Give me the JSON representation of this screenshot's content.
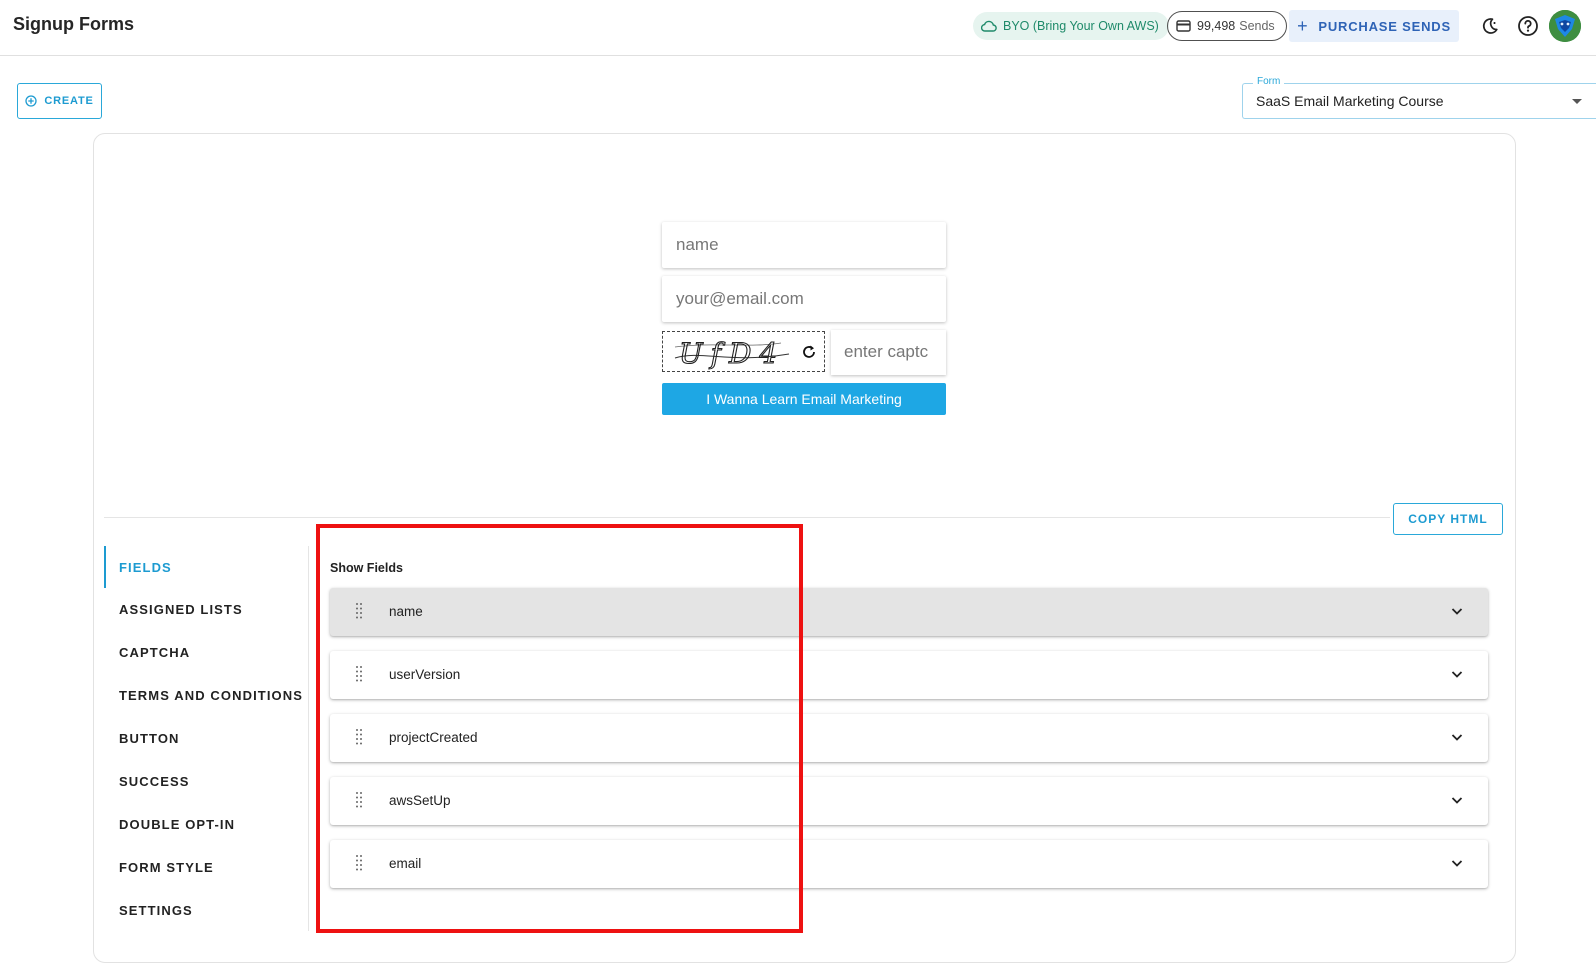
{
  "app": {
    "title": "Signup Forms"
  },
  "header": {
    "byo_label": "BYO (Bring Your Own AWS)",
    "sends_count": "99,498",
    "sends_unit": "Sends",
    "purchase_label": "PURCHASE SENDS",
    "icons": [
      "cloud-icon",
      "credit-card-icon",
      "plus-icon",
      "dark-mode-icon",
      "help-icon",
      "avatar"
    ]
  },
  "toolbar": {
    "create_label": "CREATE",
    "form_select": {
      "label": "Form",
      "value": "SaaS Email Marketing Course"
    }
  },
  "preview": {
    "name_placeholder": "name",
    "email_placeholder": "your@email.com",
    "captcha_text": "UfD4",
    "captcha_placeholder": "enter captc",
    "submit_label": "I Wanna Learn Email Marketing"
  },
  "copy_html_label": "COPY HTML",
  "tabs": [
    {
      "label": "FIELDS",
      "active": true
    },
    {
      "label": "ASSIGNED LISTS"
    },
    {
      "label": "CAPTCHA"
    },
    {
      "label": "TERMS AND CONDITIONS"
    },
    {
      "label": "BUTTON"
    },
    {
      "label": "SUCCESS"
    },
    {
      "label": "DOUBLE OPT-IN"
    },
    {
      "label": "FORM STYLE"
    },
    {
      "label": "SETTINGS"
    }
  ],
  "fields_panel": {
    "heading": "Show Fields",
    "fields": [
      {
        "name": "name",
        "expanded": true
      },
      {
        "name": "userVersion"
      },
      {
        "name": "projectCreated"
      },
      {
        "name": "awsSetUp"
      },
      {
        "name": "email"
      }
    ]
  },
  "colors": {
    "accent": "#1d9bd1",
    "button": "#1ea7e4",
    "highlight": "#ee1111",
    "byo_bg": "#e6f4ef",
    "byo_text": "#1f8a6a"
  }
}
